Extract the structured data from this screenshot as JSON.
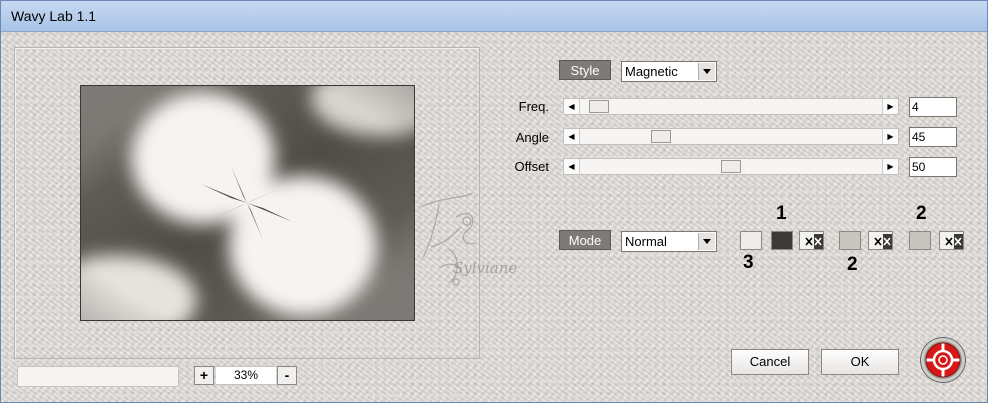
{
  "window": {
    "title": "Wavy Lab 1.1"
  },
  "colors": {
    "title_bar": "#b6cdeb",
    "panel": "#dcd8d4",
    "label_tag": "#7e7a76",
    "swatch_light": "#efedeb",
    "swatch_dark": "#3b3a35",
    "swatch_mid": "#c9c5bf",
    "swatch_mid2": "#c7c3bd",
    "help_red": "#d71818"
  },
  "style": {
    "label": "Style",
    "value": "Magnetic"
  },
  "sliders": [
    {
      "label": "Freq.",
      "value": "4",
      "position": 0.07
    },
    {
      "label": "Angle",
      "value": "45",
      "position": 0.3
    },
    {
      "label": "Offset",
      "value": "50",
      "position": 0.52
    }
  ],
  "mode": {
    "label": "Mode",
    "value": "Normal"
  },
  "annotations": {
    "n1": "1",
    "n2a": "2",
    "n2b": "2",
    "n3": "3"
  },
  "watermark": {
    "text": "Sylviane"
  },
  "zoom": {
    "plus": "+",
    "minus": "-",
    "value": "33%"
  },
  "buttons": {
    "cancel": "Cancel",
    "ok": "OK"
  },
  "icons": {
    "swap": "swap-colors-icon",
    "help": "help-lifebuoy-icon",
    "arrow_left": "arrow-left-icon",
    "arrow_right": "arrow-right-icon",
    "dropdown": "chevron-down-icon"
  }
}
